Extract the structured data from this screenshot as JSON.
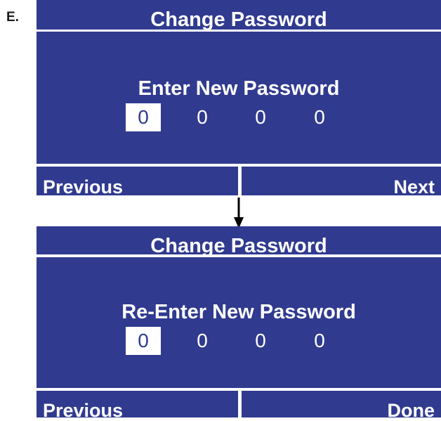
{
  "figure": {
    "label": "E."
  },
  "screens": [
    {
      "title": "Change Password",
      "prompt": "Enter New Password",
      "digits": [
        "0",
        "0",
        "0",
        "0"
      ],
      "selected_index": 0,
      "buttons": {
        "left": "Previous",
        "right": "Next"
      }
    },
    {
      "title": "Change Password",
      "prompt": "Re-Enter New Password",
      "digits": [
        "0",
        "0",
        "0",
        "0"
      ],
      "selected_index": 0,
      "buttons": {
        "left": "Previous",
        "right": "Done"
      }
    }
  ],
  "colors": {
    "screen_blue": "#303a8f",
    "divider": "#ffffff",
    "text": "#ffffff",
    "arrow": "#000000"
  }
}
